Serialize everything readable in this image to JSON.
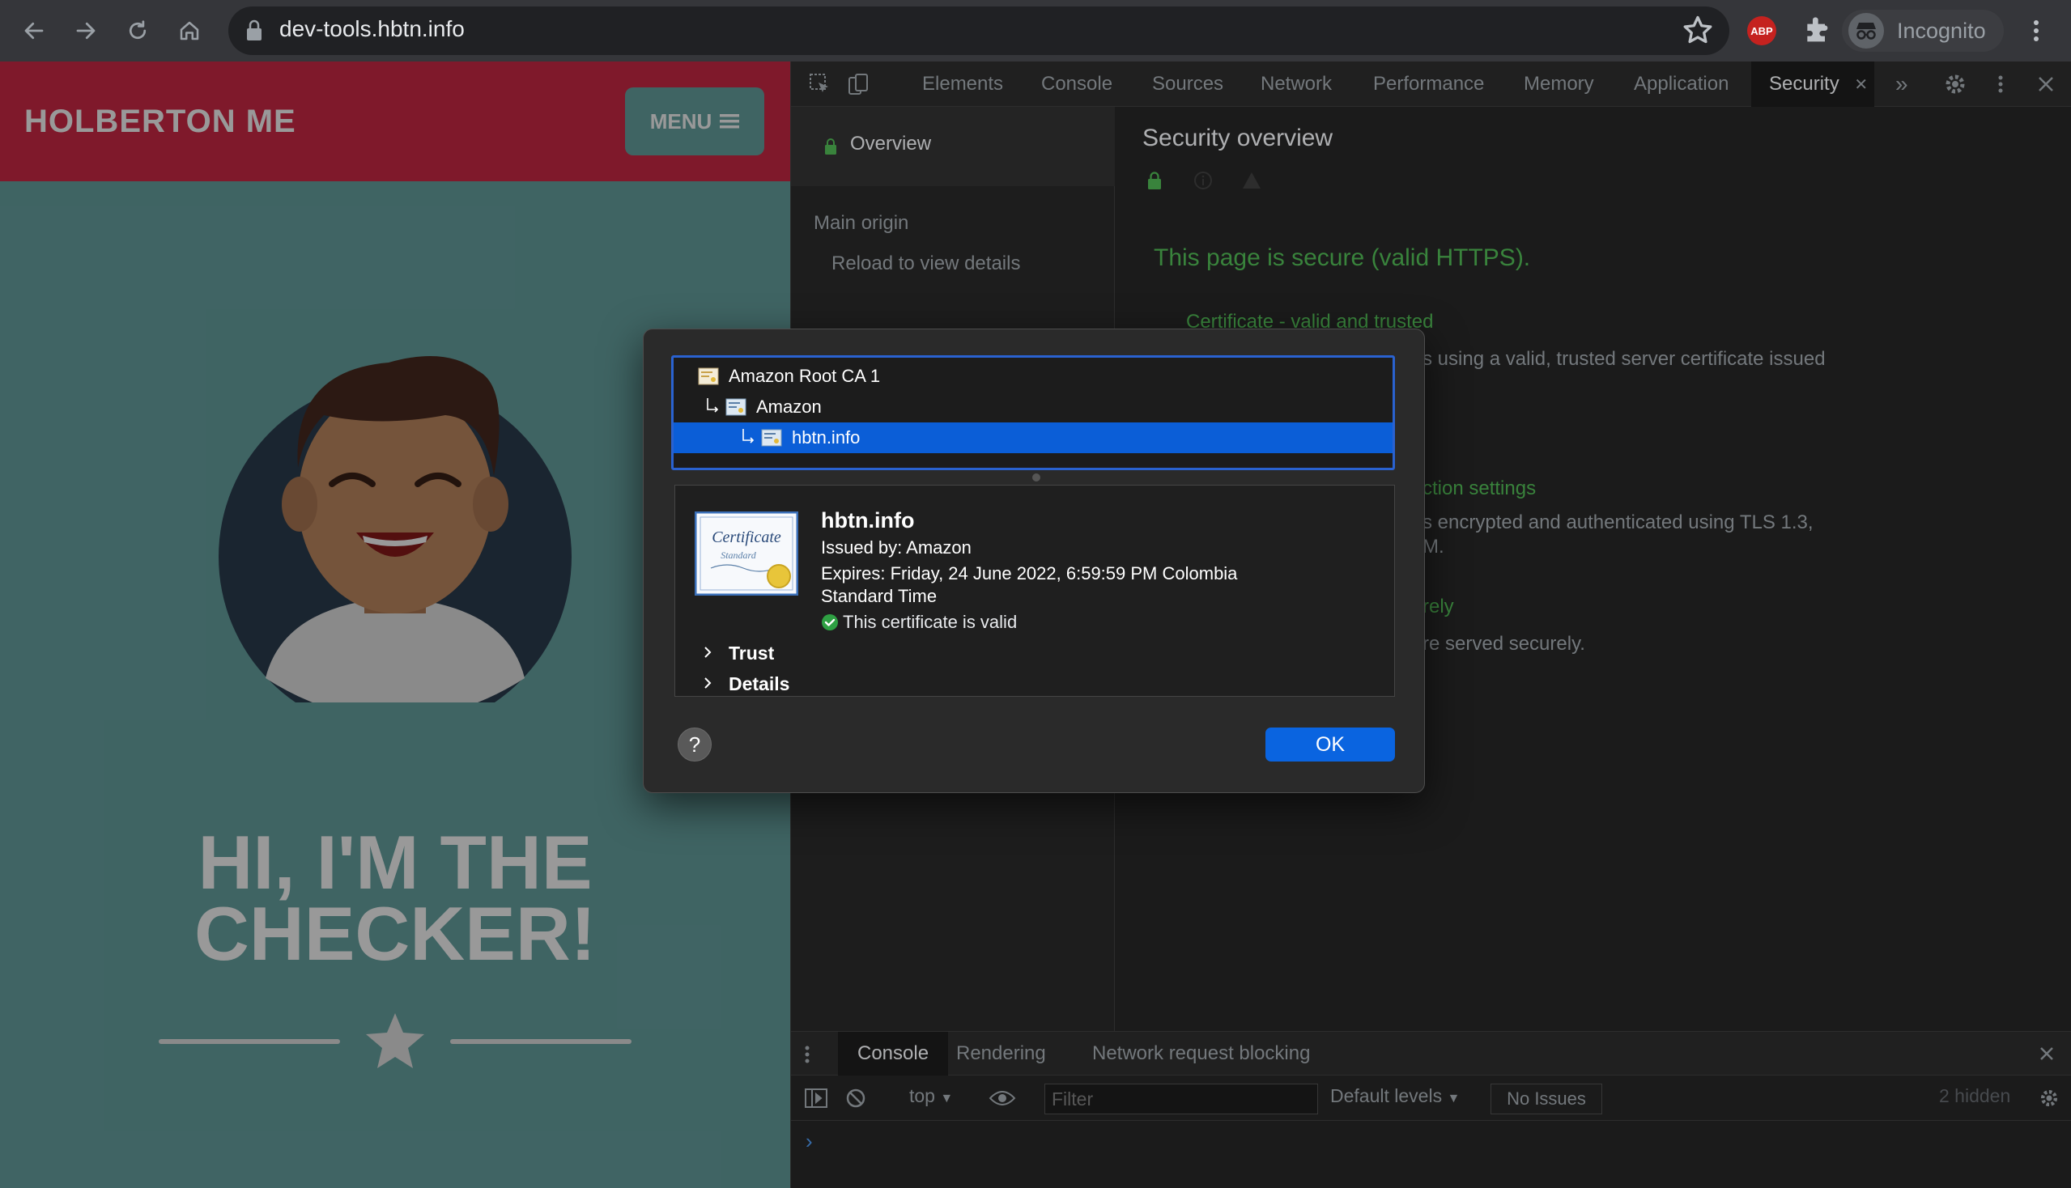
{
  "browser": {
    "url": "dev-tools.hbtn.info",
    "abp_label": "ABP",
    "profile_label": "Incognito"
  },
  "page": {
    "site_title": "HOLBERTON ME",
    "menu_label": "MENU",
    "hero_line1": "HI, I'M THE",
    "hero_line2": "CHECKER!"
  },
  "devtools": {
    "tabs": [
      "Elements",
      "Console",
      "Sources",
      "Network",
      "Performance",
      "Memory",
      "Application",
      "Security"
    ],
    "active_tab": "Security",
    "sidebar": {
      "overview": "Overview",
      "main_origin": "Main origin",
      "reload_hint": "Reload to view details"
    },
    "security": {
      "title": "Security overview",
      "secure_message": "This page is secure (valid HTTPS).",
      "certificate_heading": "Certificate - valid and trusted",
      "certificate_text_fragment": "s using a valid, trusted server certificate issued",
      "connection_heading_fragment": "ction settings",
      "connection_text_fragment": "s encrypted and authenticated using TLS 1.3,",
      "connection_text_fragment2": "M.",
      "resources_heading_fragment": "rely",
      "resources_text_fragment": "re served securely."
    },
    "drawer": {
      "tabs": [
        "Console",
        "Rendering",
        "Network request blocking"
      ],
      "context": "top",
      "filter_placeholder": "Filter",
      "levels": "Default levels",
      "issues": "No Issues",
      "hidden": "2 hidden",
      "prompt": "›"
    }
  },
  "cert_dialog": {
    "chain": [
      "Amazon Root CA 1",
      "Amazon",
      "hbtn.info"
    ],
    "selected_index": 2,
    "name": "hbtn.info",
    "issued_by": "Issued by: Amazon",
    "expires_line1": "Expires: Friday, 24 June 2022, 6:59:59 PM Colombia",
    "expires_line2": "Standard Time",
    "valid_text": "This certificate is valid",
    "trust_label": "Trust",
    "details_label": "Details",
    "help_label": "?",
    "ok_label": "OK",
    "cert_image_text1": "Certificate",
    "cert_image_text2": "Standard"
  },
  "colors": {
    "accent": "#0a64e0",
    "secure_green": "#4caf50",
    "site_red": "#d42a49",
    "site_teal": "#6aa7a6"
  }
}
